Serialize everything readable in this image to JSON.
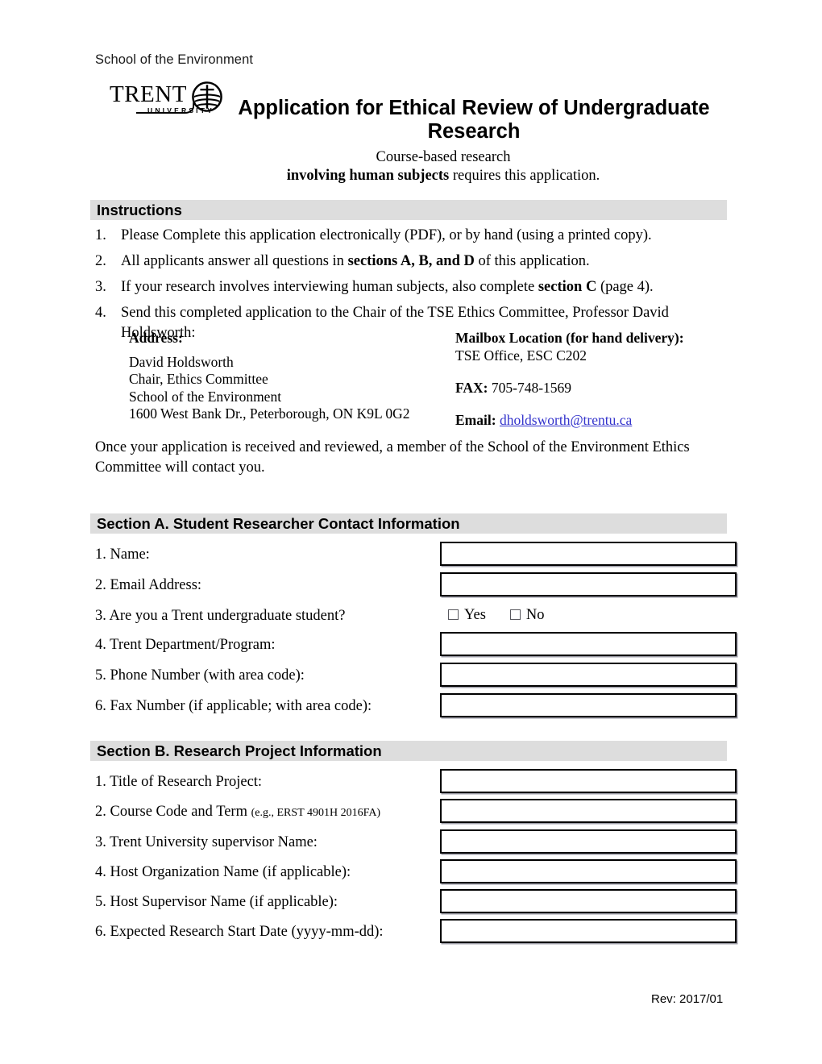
{
  "header": {
    "dept": "School of the Environment",
    "logo": {
      "word": "TRENT",
      "sub": "UNIVERSITY"
    },
    "title": "Application for Ethical Review of Undergraduate Research",
    "subtitle_line1": "Course-based research",
    "subtitle_bold": "involving human subjects",
    "subtitle_rest": " requires this application."
  },
  "instructions": {
    "heading": "Instructions",
    "items": [
      {
        "num": "1.",
        "pre": "Please Complete this application electronically (PDF), or by hand (using a printed copy).",
        "bold": "",
        "post": ""
      },
      {
        "num": "2.",
        "pre": "All applicants answer all questions in ",
        "bold": "sections A, B, and D",
        "post": " of this application."
      },
      {
        "num": "3.",
        "pre": "If your research involves interviewing human subjects, also complete ",
        "bold": "section C",
        "post": " (page 4)."
      },
      {
        "num": "4.",
        "pre": "Send this completed application to the Chair of the TSE Ethics Committee, Professor David Holdsworth:",
        "bold": "",
        "post": ""
      }
    ]
  },
  "contact": {
    "address_heading": "Address:",
    "address_lines": [
      "David Holdsworth",
      "Chair, Ethics Committee",
      "School of the Environment",
      "1600 West Bank Dr., Peterborough, ON  K9L 0G2"
    ],
    "mailbox_heading": "Mailbox Location (for hand delivery):",
    "mailbox_value": "TSE Office, ESC C202",
    "fax_label": "FAX:",
    "fax_value": " 705-748-1569",
    "email_label": "Email:",
    "email_value": "dholdsworth@trentu.ca",
    "email_color": "#3333cc"
  },
  "closing": "Once your application is received and reviewed, a member of the School of the Environment Ethics Committee will contact you.",
  "section_a": {
    "heading": "Section A. Student Researcher Contact Information",
    "rows": [
      {
        "label": "1.  Name:",
        "type": "field",
        "value": ""
      },
      {
        "label": "2.  Email Address:",
        "type": "field",
        "value": ""
      },
      {
        "label": "3.  Are you a Trent undergraduate student?",
        "type": "checkbox",
        "options": [
          "Yes",
          "No"
        ]
      },
      {
        "label": "4.  Trent Department/Program:",
        "type": "field",
        "value": ""
      },
      {
        "label": "5.  Phone Number (with area code):",
        "type": "field",
        "value": ""
      },
      {
        "label": "6.  Fax Number (if applicable; with area code):",
        "type": "field",
        "value": ""
      }
    ]
  },
  "section_b": {
    "heading": "Section B. Research Project Information",
    "rows": [
      {
        "label": "1. Title of Research Project:",
        "small": "",
        "type": "field",
        "value": ""
      },
      {
        "label": "2. Course Code and Term ",
        "small": "(e.g., ERST 4901H 2016FA)",
        "type": "field",
        "value": ""
      },
      {
        "label": "3. Trent University supervisor Name:",
        "small": "",
        "type": "field",
        "value": ""
      },
      {
        "label": "4. Host Organization Name (if applicable):",
        "small": "",
        "type": "field",
        "value": ""
      },
      {
        "label": "5. Host Supervisor Name (if applicable):",
        "small": "",
        "type": "field",
        "value": ""
      },
      {
        "label": "6. Expected Research Start Date (yyyy-mm-dd):",
        "small": "",
        "type": "field",
        "value": ""
      }
    ]
  },
  "footer": {
    "revision": "Rev: 2017/01"
  },
  "colors": {
    "section_bar": "#dddddd",
    "link": "#3333cc",
    "text": "#000000"
  }
}
